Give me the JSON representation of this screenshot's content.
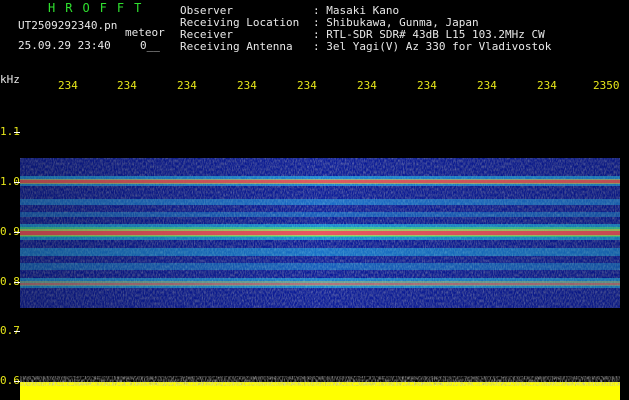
{
  "header": {
    "brand": "HROFFT",
    "filename": "UT2509292340.pn",
    "tag": "meteor",
    "datetime": "25.09.29 23:40",
    "counter": "0__",
    "observer_label": "Observer",
    "observer_value": ": Masaki Kano",
    "location_label": "Receiving Location",
    "location_value": ": Shibukawa, Gunma, Japan",
    "receiver_label": "Receiver",
    "receiver_value": ": RTL-SDR SDR# 43dB L15 103.2MHz CW",
    "antenna_label": "Receiving Antenna",
    "antenna_value": ": 3el Yagi(V) Az 330 for Vladivostok"
  },
  "axis": {
    "y_unit": "kHz",
    "y_ticks": [
      "1.1",
      "1.0",
      "0.9",
      "0.8",
      "0.7",
      "0.6"
    ],
    "x_ticks": [
      "234",
      "234",
      "234",
      "234",
      "234",
      "234",
      "234",
      "234",
      "234",
      "2350"
    ]
  },
  "colors": {
    "background": "#000000",
    "header_text": "#e8e8e8",
    "brand": "#2fe02f",
    "axis_labels": "#e6e619"
  }
}
